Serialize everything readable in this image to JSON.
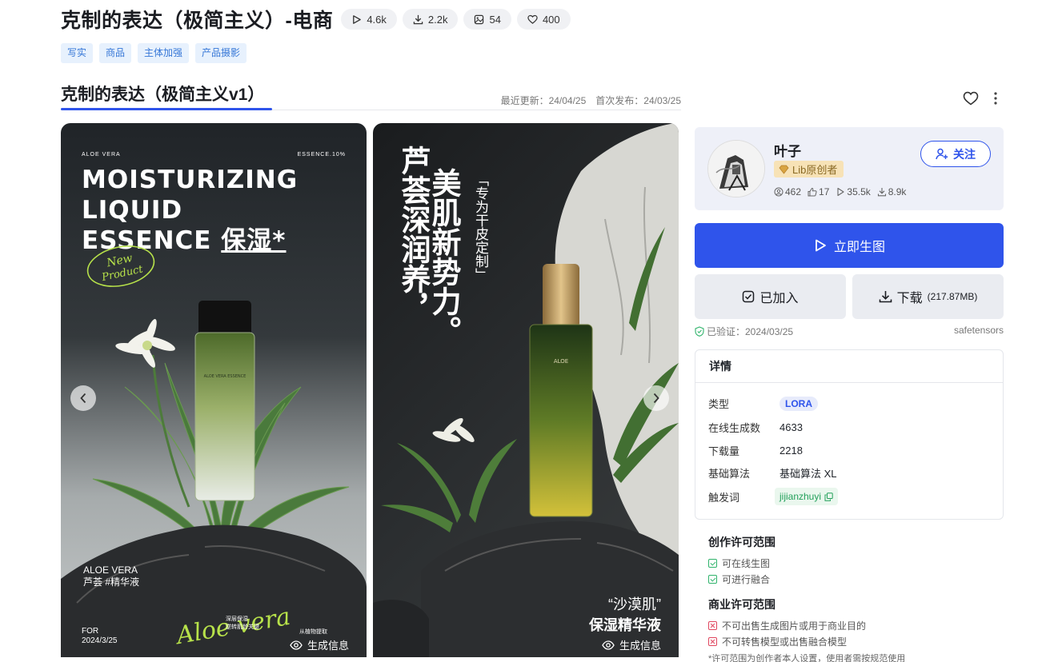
{
  "header": {
    "title": "克制的表达（极简主义）-电商",
    "stats": {
      "runs": "4.6k",
      "downloads": "2.2k",
      "images": "54",
      "likes": "400"
    },
    "tags": [
      "写实",
      "商品",
      "主体加强",
      "产品摄影"
    ]
  },
  "version": {
    "title": "克制的表达（极简主义v1）",
    "last_updated": "最近更新：24/04/25",
    "first_published": "首次发布：24/03/25"
  },
  "gallery": {
    "card1": {
      "brand_left": "ALOE VERA",
      "brand_right": "ESSENCE.10%",
      "headline_1": "MOISTURIZING",
      "headline_2": "LIQUID",
      "headline_3": "ESSENCE",
      "headline_cn": "保湿*",
      "new_product_1": "New",
      "new_product_2": "Product",
      "aloe_tag_1": "ALOE VERA",
      "aloe_tag_2": "芦荟 #精华液",
      "for_1": "FOR",
      "for_2": "2024/3/25",
      "mid_1": "深层保湿",
      "mid_2": "逆转肌龄关键",
      "right_note": "从植物提取",
      "script": "Aloe vera",
      "bottle_label": "ALOE VERA ESSENCE"
    },
    "card2": {
      "col1": "芦荟深润养，",
      "col2": "美肌新势力。",
      "col3": "「专为干皮定制」",
      "bottom_1": "“沙漠肌”",
      "bottom_2": "保湿精华液",
      "bottle_label": "ALOE"
    },
    "gen_info_label": "生成信息"
  },
  "creator": {
    "name": "叶子",
    "badge": "Lib原创者",
    "followers": "462",
    "likes": "17",
    "runs": "35.5k",
    "downloads": "8.9k",
    "follow_label": "关注"
  },
  "actions": {
    "generate_label": "立即生图",
    "added_label": "已加入",
    "download_label": "下载",
    "download_size": "(217.87MB)"
  },
  "verify": {
    "text": "已验证：2024/03/25",
    "format": "safetensors"
  },
  "details": {
    "title": "详情",
    "rows": [
      {
        "key": "类型",
        "value": "LORA"
      },
      {
        "key": "在线生成数",
        "value": "4633"
      },
      {
        "key": "下载量",
        "value": "2218"
      },
      {
        "key": "基础算法",
        "value": "基础算法 XL"
      },
      {
        "key": "触发词",
        "value": "jijianzhuyi"
      }
    ]
  },
  "license": {
    "creation_title": "创作许可范围",
    "creation_items": [
      "可在线生图",
      "可进行融合"
    ],
    "commercial_title": "商业许可范围",
    "commercial_items": [
      "不可出售生成图片或用于商业目的",
      "不可转售模型或出售融合模型"
    ],
    "note": "*许可范围为创作者本人设置，使用者需按规范使用"
  },
  "colors": {
    "primary": "#2f54eb",
    "tag_bg": "#e7f1fd",
    "tag_text": "#3677d7",
    "ok_green": "#2fb36b",
    "deny_red": "#e0475f",
    "badge_gold": "#f7e2b6"
  }
}
